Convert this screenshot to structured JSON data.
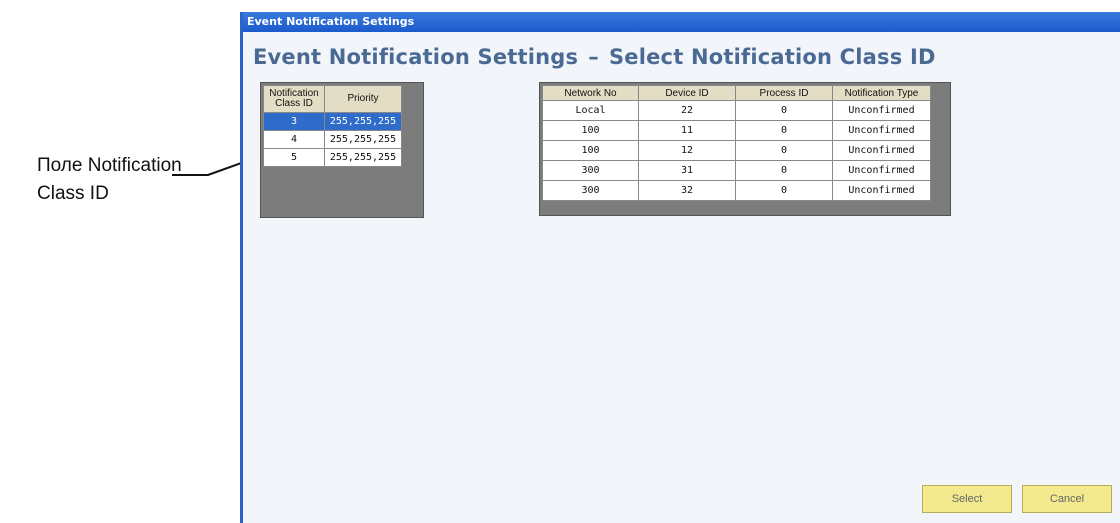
{
  "window": {
    "title": "Event Notification Settings",
    "heading_left": "Event Notification Settings",
    "heading_dash": "–",
    "heading_right": "Select Notification Class ID"
  },
  "callout": {
    "line1": "Поле Notification",
    "line2": "Class ID",
    "marker_color": "#e03030"
  },
  "class_table": {
    "headers": [
      "Notification Class ID",
      "Priority"
    ],
    "selected_index": 0,
    "rows": [
      {
        "class_id": "3",
        "priority": "255,255,255"
      },
      {
        "class_id": "4",
        "priority": "255,255,255"
      },
      {
        "class_id": "5",
        "priority": "255,255,255"
      }
    ]
  },
  "recipient_table": {
    "headers": [
      "Network No",
      "Device ID",
      "Process ID",
      "Notification Type"
    ],
    "rows": [
      {
        "network": "Local",
        "device": "22",
        "process": "0",
        "type": "Unconfirmed"
      },
      {
        "network": "100",
        "device": "11",
        "process": "0",
        "type": "Unconfirmed"
      },
      {
        "network": "100",
        "device": "12",
        "process": "0",
        "type": "Unconfirmed"
      },
      {
        "network": "300",
        "device": "31",
        "process": "0",
        "type": "Unconfirmed"
      },
      {
        "network": "300",
        "device": "32",
        "process": "0",
        "type": "Unconfirmed"
      }
    ]
  },
  "buttons": {
    "select": "Select",
    "cancel": "Cancel"
  },
  "colors": {
    "titlebar": "#1b5acb",
    "heading": "#4a6a94",
    "selected_row": "#2f6cc9",
    "button": "#f3e98f"
  }
}
